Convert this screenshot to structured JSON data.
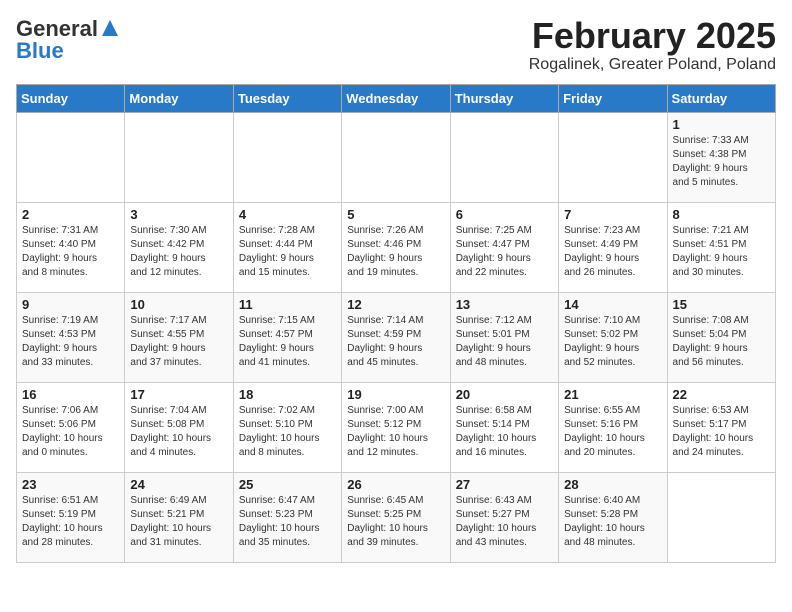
{
  "header": {
    "logo_line1": "General",
    "logo_line2": "Blue",
    "title": "February 2025",
    "subtitle": "Rogalinek, Greater Poland, Poland"
  },
  "weekdays": [
    "Sunday",
    "Monday",
    "Tuesday",
    "Wednesday",
    "Thursday",
    "Friday",
    "Saturday"
  ],
  "weeks": [
    [
      {
        "day": "",
        "info": ""
      },
      {
        "day": "",
        "info": ""
      },
      {
        "day": "",
        "info": ""
      },
      {
        "day": "",
        "info": ""
      },
      {
        "day": "",
        "info": ""
      },
      {
        "day": "",
        "info": ""
      },
      {
        "day": "1",
        "info": "Sunrise: 7:33 AM\nSunset: 4:38 PM\nDaylight: 9 hours\nand 5 minutes."
      }
    ],
    [
      {
        "day": "2",
        "info": "Sunrise: 7:31 AM\nSunset: 4:40 PM\nDaylight: 9 hours\nand 8 minutes."
      },
      {
        "day": "3",
        "info": "Sunrise: 7:30 AM\nSunset: 4:42 PM\nDaylight: 9 hours\nand 12 minutes."
      },
      {
        "day": "4",
        "info": "Sunrise: 7:28 AM\nSunset: 4:44 PM\nDaylight: 9 hours\nand 15 minutes."
      },
      {
        "day": "5",
        "info": "Sunrise: 7:26 AM\nSunset: 4:46 PM\nDaylight: 9 hours\nand 19 minutes."
      },
      {
        "day": "6",
        "info": "Sunrise: 7:25 AM\nSunset: 4:47 PM\nDaylight: 9 hours\nand 22 minutes."
      },
      {
        "day": "7",
        "info": "Sunrise: 7:23 AM\nSunset: 4:49 PM\nDaylight: 9 hours\nand 26 minutes."
      },
      {
        "day": "8",
        "info": "Sunrise: 7:21 AM\nSunset: 4:51 PM\nDaylight: 9 hours\nand 30 minutes."
      }
    ],
    [
      {
        "day": "9",
        "info": "Sunrise: 7:19 AM\nSunset: 4:53 PM\nDaylight: 9 hours\nand 33 minutes."
      },
      {
        "day": "10",
        "info": "Sunrise: 7:17 AM\nSunset: 4:55 PM\nDaylight: 9 hours\nand 37 minutes."
      },
      {
        "day": "11",
        "info": "Sunrise: 7:15 AM\nSunset: 4:57 PM\nDaylight: 9 hours\nand 41 minutes."
      },
      {
        "day": "12",
        "info": "Sunrise: 7:14 AM\nSunset: 4:59 PM\nDaylight: 9 hours\nand 45 minutes."
      },
      {
        "day": "13",
        "info": "Sunrise: 7:12 AM\nSunset: 5:01 PM\nDaylight: 9 hours\nand 48 minutes."
      },
      {
        "day": "14",
        "info": "Sunrise: 7:10 AM\nSunset: 5:02 PM\nDaylight: 9 hours\nand 52 minutes."
      },
      {
        "day": "15",
        "info": "Sunrise: 7:08 AM\nSunset: 5:04 PM\nDaylight: 9 hours\nand 56 minutes."
      }
    ],
    [
      {
        "day": "16",
        "info": "Sunrise: 7:06 AM\nSunset: 5:06 PM\nDaylight: 10 hours\nand 0 minutes."
      },
      {
        "day": "17",
        "info": "Sunrise: 7:04 AM\nSunset: 5:08 PM\nDaylight: 10 hours\nand 4 minutes."
      },
      {
        "day": "18",
        "info": "Sunrise: 7:02 AM\nSunset: 5:10 PM\nDaylight: 10 hours\nand 8 minutes."
      },
      {
        "day": "19",
        "info": "Sunrise: 7:00 AM\nSunset: 5:12 PM\nDaylight: 10 hours\nand 12 minutes."
      },
      {
        "day": "20",
        "info": "Sunrise: 6:58 AM\nSunset: 5:14 PM\nDaylight: 10 hours\nand 16 minutes."
      },
      {
        "day": "21",
        "info": "Sunrise: 6:55 AM\nSunset: 5:16 PM\nDaylight: 10 hours\nand 20 minutes."
      },
      {
        "day": "22",
        "info": "Sunrise: 6:53 AM\nSunset: 5:17 PM\nDaylight: 10 hours\nand 24 minutes."
      }
    ],
    [
      {
        "day": "23",
        "info": "Sunrise: 6:51 AM\nSunset: 5:19 PM\nDaylight: 10 hours\nand 28 minutes."
      },
      {
        "day": "24",
        "info": "Sunrise: 6:49 AM\nSunset: 5:21 PM\nDaylight: 10 hours\nand 31 minutes."
      },
      {
        "day": "25",
        "info": "Sunrise: 6:47 AM\nSunset: 5:23 PM\nDaylight: 10 hours\nand 35 minutes."
      },
      {
        "day": "26",
        "info": "Sunrise: 6:45 AM\nSunset: 5:25 PM\nDaylight: 10 hours\nand 39 minutes."
      },
      {
        "day": "27",
        "info": "Sunrise: 6:43 AM\nSunset: 5:27 PM\nDaylight: 10 hours\nand 43 minutes."
      },
      {
        "day": "28",
        "info": "Sunrise: 6:40 AM\nSunset: 5:28 PM\nDaylight: 10 hours\nand 48 minutes."
      },
      {
        "day": "",
        "info": ""
      }
    ]
  ]
}
